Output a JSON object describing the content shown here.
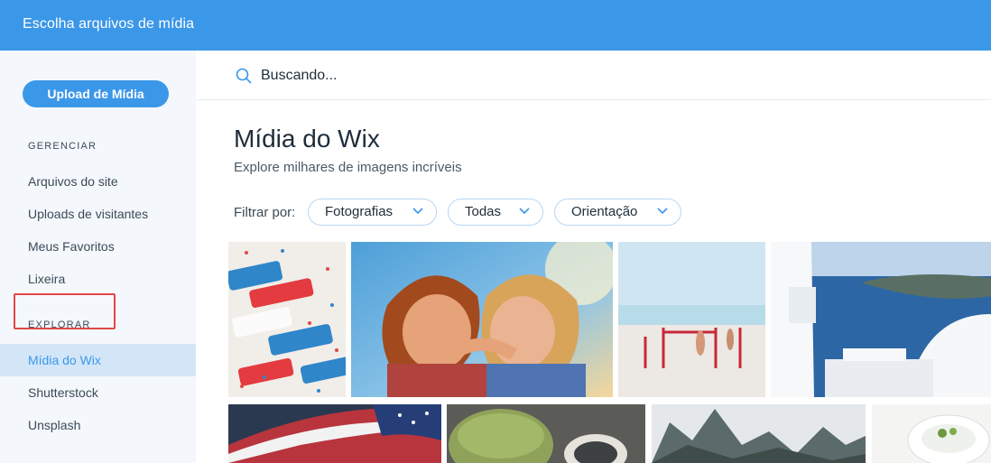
{
  "header": {
    "title": "Escolha arquivos de mídia"
  },
  "sidebar": {
    "upload_label": "Upload de Mídia",
    "manage_section": "GERENCIAR",
    "manage_items": [
      "Arquivos do site",
      "Uploads de visitantes",
      "Meus Favoritos",
      "Lixeira"
    ],
    "explore_section": "EXPLORAR",
    "explore_items": [
      "Mídia do Wix",
      "Shutterstock",
      "Unsplash"
    ],
    "active_item": "Mídia do Wix"
  },
  "search": {
    "placeholder": "Buscando..."
  },
  "main": {
    "title": "Mídia do Wix",
    "subtitle": "Explore milhares de imagens incríveis",
    "filter_label": "Filtrar por:",
    "filters": [
      "Fotografias",
      "Todas",
      "Orientação"
    ]
  },
  "colors": {
    "accent": "#3b97e8",
    "sidebar_bg": "#f4f8fc",
    "active_bg": "#d3e6f8",
    "highlight": "#e04848"
  },
  "icons": {
    "search": "search-icon",
    "chevron": "chevron-down-icon"
  }
}
